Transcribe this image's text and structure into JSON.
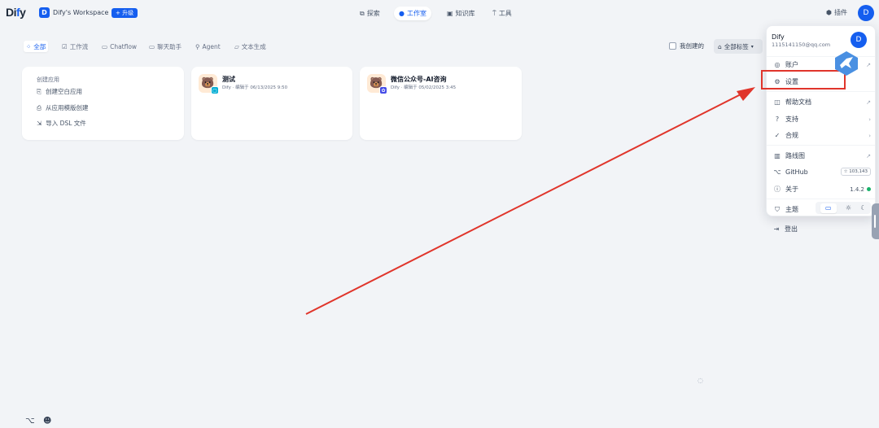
{
  "header": {
    "logo_prefix": "Di",
    "logo_i": "f",
    "logo_suffix": "y",
    "workspace_badge": "D",
    "workspace_name": "Dify's Workspace",
    "upgrade_label": "+ 升级",
    "nav": [
      {
        "label": "探索",
        "icon": "compass-icon"
      },
      {
        "label": "工作室",
        "icon": "robot-icon",
        "active": true
      },
      {
        "label": "知识库",
        "icon": "book-icon"
      },
      {
        "label": "工具",
        "icon": "tool-icon"
      }
    ],
    "plugins_label": "插件",
    "avatar_letter": "D"
  },
  "filters": {
    "tabs": [
      {
        "label": "全部",
        "icon": "grid-icon",
        "active": true
      },
      {
        "label": "工作流",
        "icon": "workflow-icon"
      },
      {
        "label": "Chatflow",
        "icon": "chatflow-icon"
      },
      {
        "label": "聊天助手",
        "icon": "chat-icon"
      },
      {
        "label": "Agent",
        "icon": "agent-icon"
      },
      {
        "label": "文本生成",
        "icon": "text-icon"
      }
    ],
    "mine_label": "我创建的",
    "tag_label": "全部标签"
  },
  "create_card": {
    "heading": "创建应用",
    "blank": "创建空白应用",
    "template": "从应用模版创建",
    "dsl": "导入 DSL 文件"
  },
  "apps": [
    {
      "name": "测试",
      "meta": "Dify · 编辑于 06/13/2025 9:50",
      "icon": "bear-icon",
      "badge_color": "#06aed4"
    },
    {
      "name": "微信公众号-AI咨询",
      "meta": "Dify · 编辑于 05/02/2025 3:45",
      "icon": "bear-icon",
      "badge_color": "#444ce7"
    }
  ],
  "menu": {
    "user_name": "Dify",
    "email": "1115141150@qq.com",
    "avatar_letter": "D",
    "items": {
      "account": "账户",
      "settings": "设置",
      "help": "帮助文档",
      "support": "支持",
      "compliance": "合规",
      "roadmap": "路线图",
      "github": "GitHub",
      "github_stars": "☆ 103,143",
      "about": "关于",
      "version": "1.4.2",
      "theme": "主题",
      "logout": "登出"
    }
  },
  "colors": {
    "accent": "#155eef",
    "annotation": "#e0352b",
    "status_ok": "#17b26a"
  }
}
